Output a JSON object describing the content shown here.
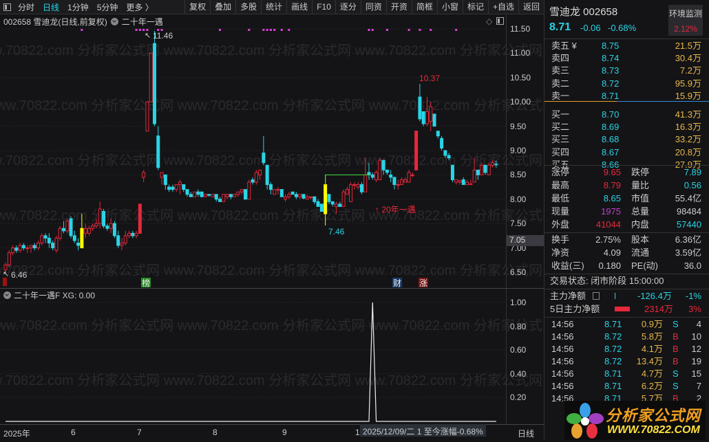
{
  "toolbar": {
    "left": [
      "分时",
      "日线",
      "1分钟",
      "5分钟",
      "更多 〉"
    ],
    "active": "日线",
    "right": [
      "复权",
      "叠加",
      "多股",
      "统计",
      "画线",
      "F10",
      "逐分",
      "同资",
      "开资",
      "简框",
      "小窗",
      "标记",
      "+自选",
      "返回"
    ]
  },
  "chart": {
    "code": "002658",
    "name_line": "002658 雪迪龙(日线,前复权)",
    "indicator": "二十年一遇",
    "price_ticks": [
      "11.50",
      "11.00",
      "10.50",
      "10.00",
      "9.50",
      "9.00",
      "8.50",
      "8.00",
      "7.50",
      "7.00",
      "6.50"
    ],
    "crosshair_price": "7.05",
    "labels": {
      "high": "11.46",
      "low": "6.46",
      "low2": "7.46",
      "high2": "10.37",
      "signal": "↑ 20年一遇"
    },
    "badges": [
      "榜",
      "财",
      "涨"
    ],
    "colors": {
      "up": "#e8283c",
      "down": "#2ad4e6",
      "signal": "#ffff00",
      "marker": "#e040e0"
    },
    "candles": [
      [
        6.55,
        6.7,
        6.46,
        6.65
      ],
      [
        6.65,
        6.95,
        6.6,
        6.9
      ],
      [
        6.9,
        7.05,
        6.85,
        7.0
      ],
      [
        7.0,
        7.05,
        6.9,
        6.95
      ],
      [
        6.95,
        7.1,
        6.9,
        7.05
      ],
      [
        7.05,
        7.1,
        6.95,
        7.0
      ],
      [
        7.0,
        7.05,
        6.9,
        7.0
      ],
      [
        7.0,
        7.05,
        6.9,
        7.05
      ],
      [
        7.05,
        7.1,
        6.95,
        7.0
      ],
      [
        7.0,
        7.15,
        6.95,
        7.1
      ],
      [
        7.1,
        7.3,
        7.05,
        7.25
      ],
      [
        7.25,
        7.3,
        7.1,
        7.2
      ],
      [
        7.2,
        7.3,
        7.0,
        7.1
      ],
      [
        7.1,
        7.15,
        6.95,
        7.0
      ],
      [
        6.95,
        7.25,
        6.9,
        7.2
      ],
      [
        7.2,
        7.45,
        7.15,
        7.4
      ],
      [
        7.4,
        7.55,
        7.3,
        7.35
      ],
      [
        7.35,
        7.6,
        7.3,
        7.55
      ],
      [
        7.6,
        7.65,
        7.2,
        7.25
      ],
      [
        7.25,
        7.35,
        7.1,
        7.15
      ],
      [
        7.1,
        7.2,
        6.95,
        7.05
      ],
      [
        7.4,
        7.7,
        7.0,
        7.0
      ],
      [
        7.3,
        7.5,
        7.2,
        7.4
      ],
      [
        7.3,
        7.45,
        7.25,
        7.4
      ],
      [
        7.4,
        7.5,
        7.35,
        7.45
      ],
      [
        7.45,
        7.6,
        7.4,
        7.5
      ],
      [
        7.5,
        7.95,
        7.4,
        7.8
      ],
      [
        7.75,
        7.8,
        7.4,
        7.45
      ],
      [
        7.45,
        7.5,
        7.35,
        7.4
      ],
      [
        7.4,
        7.6,
        7.3,
        7.5
      ],
      [
        7.5,
        7.55,
        7.2,
        7.25
      ],
      [
        7.25,
        7.35,
        7.0,
        7.05
      ],
      [
        7.05,
        7.2,
        6.95,
        7.1
      ],
      [
        7.1,
        7.35,
        7.05,
        7.25
      ],
      [
        7.25,
        7.35,
        7.2,
        7.3
      ],
      [
        7.3,
        7.35,
        7.2,
        7.25
      ],
      [
        7.25,
        7.35,
        7.2,
        7.3
      ],
      [
        7.3,
        7.9,
        7.3,
        7.9
      ],
      [
        8.45,
        8.6,
        8.35,
        8.55
      ],
      [
        9.4,
        10.0,
        9.4,
        10.0
      ],
      [
        10.0,
        11.0,
        10.0,
        11.0
      ],
      [
        11.2,
        11.46,
        9.5,
        9.55
      ],
      [
        9.3,
        9.5,
        8.6,
        8.65
      ],
      [
        8.45,
        8.55,
        8.3,
        8.55
      ],
      [
        8.5,
        8.5,
        8.2,
        8.3
      ],
      [
        8.25,
        8.3,
        8.15,
        8.2
      ],
      [
        8.25,
        8.3,
        8.15,
        8.2
      ],
      [
        8.2,
        8.3,
        8.15,
        8.3
      ],
      [
        8.3,
        8.4,
        8.1,
        8.35
      ],
      [
        8.3,
        8.3,
        8.15,
        8.2
      ],
      [
        8.2,
        8.2,
        8.05,
        8.1
      ],
      [
        8.1,
        8.15,
        8.05,
        8.05
      ],
      [
        8.05,
        8.15,
        8.05,
        8.15
      ],
      [
        8.15,
        8.2,
        8.05,
        8.1
      ],
      [
        8.15,
        8.15,
        8.05,
        8.05
      ],
      [
        8.05,
        8.1,
        8.05,
        8.1
      ],
      [
        8.1,
        8.1,
        8.05,
        8.08
      ],
      [
        8.05,
        8.1,
        8.05,
        8.1
      ],
      [
        8.1,
        8.1,
        7.95,
        8.0
      ],
      [
        8.0,
        8.05,
        7.95,
        7.95
      ],
      [
        7.95,
        8.1,
        7.95,
        8.1
      ],
      [
        8.05,
        8.1,
        8.0,
        8.1
      ],
      [
        8.1,
        8.1,
        8.0,
        8.05
      ],
      [
        8.05,
        8.1,
        8.05,
        8.1
      ],
      [
        8.1,
        8.15,
        8.05,
        8.15
      ],
      [
        8.15,
        8.2,
        8.1,
        8.2
      ],
      [
        8.2,
        8.2,
        8.0,
        8.0
      ],
      [
        8.0,
        8.4,
        8.0,
        8.35
      ],
      [
        8.4,
        8.45,
        8.3,
        8.35
      ],
      [
        8.35,
        8.6,
        8.3,
        8.55
      ],
      [
        8.5,
        8.6,
        8.4,
        8.6
      ],
      [
        8.95,
        9.3,
        8.7,
        8.75
      ],
      [
        8.7,
        8.7,
        8.2,
        8.3
      ],
      [
        8.3,
        8.35,
        8.1,
        8.2
      ],
      [
        8.1,
        8.2,
        8.1,
        8.2
      ],
      [
        8.2,
        8.25,
        8.1,
        8.2
      ],
      [
        8.2,
        8.2,
        8.05,
        8.05
      ],
      [
        8.0,
        8.1,
        7.95,
        8.05
      ],
      [
        8.05,
        8.15,
        8.0,
        8.1
      ],
      [
        8.15,
        8.15,
        8.1,
        8.1
      ],
      [
        8.1,
        8.15,
        8.0,
        8.05
      ],
      [
        8.05,
        8.1,
        8.0,
        8.1
      ],
      [
        8.1,
        8.1,
        8.0,
        8.02
      ],
      [
        8.0,
        8.1,
        8.0,
        8.05
      ],
      [
        8.05,
        8.05,
        8.0,
        8.05
      ],
      [
        8.05,
        8.05,
        7.9,
        7.95
      ],
      [
        7.95,
        8.0,
        7.85,
        7.85
      ],
      [
        7.9,
        7.9,
        7.75,
        7.75
      ],
      [
        8.3,
        8.5,
        7.46,
        7.7
      ],
      [
        8.1,
        8.1,
        7.9,
        7.95
      ],
      [
        7.95,
        7.95,
        7.85,
        7.9
      ],
      [
        7.85,
        7.95,
        7.7,
        7.9
      ],
      [
        7.9,
        7.95,
        7.85,
        7.85
      ],
      [
        7.85,
        8.2,
        7.85,
        8.15
      ],
      [
        8.1,
        8.25,
        8.1,
        8.2
      ],
      [
        7.95,
        8.35,
        7.95,
        8.3
      ],
      [
        8.3,
        8.35,
        8.2,
        8.3
      ],
      [
        8.25,
        8.35,
        8.2,
        8.3
      ],
      [
        8.3,
        8.35,
        8.1,
        8.15
      ],
      [
        8.15,
        8.85,
        8.15,
        8.5
      ],
      [
        8.55,
        8.75,
        8.4,
        8.5
      ],
      [
        8.5,
        8.55,
        8.4,
        8.45
      ],
      [
        8.4,
        8.6,
        8.35,
        8.55
      ],
      [
        8.4,
        8.85,
        8.4,
        8.8
      ],
      [
        8.8,
        8.8,
        8.5,
        8.6
      ],
      [
        8.6,
        8.6,
        8.5,
        8.55
      ],
      [
        8.5,
        8.6,
        8.35,
        8.45
      ],
      [
        8.45,
        8.45,
        8.2,
        8.3
      ],
      [
        8.3,
        8.4,
        8.2,
        8.3
      ],
      [
        8.3,
        8.45,
        8.3,
        8.4
      ],
      [
        8.35,
        8.45,
        8.35,
        8.4
      ],
      [
        8.35,
        8.6,
        8.35,
        8.55
      ],
      [
        8.5,
        8.55,
        8.45,
        8.5
      ],
      [
        8.6,
        9.4,
        8.6,
        9.4
      ],
      [
        10.1,
        10.37,
        9.6,
        9.65
      ],
      [
        9.8,
        9.8,
        9.5,
        9.55
      ],
      [
        9.55,
        10.1,
        9.5,
        9.8
      ],
      [
        9.6,
        10.0,
        9.4,
        9.9
      ],
      [
        9.75,
        9.75,
        9.5,
        9.5
      ],
      [
        9.4,
        9.4,
        9.25,
        9.3
      ],
      [
        9.25,
        9.3,
        9.0,
        9.05
      ],
      [
        9.0,
        9.0,
        8.85,
        8.9
      ],
      [
        8.9,
        8.95,
        8.8,
        8.85
      ],
      [
        8.7,
        8.7,
        8.35,
        8.4
      ],
      [
        8.35,
        8.4,
        8.3,
        8.4
      ],
      [
        8.35,
        8.4,
        8.3,
        8.38
      ],
      [
        8.4,
        8.45,
        8.3,
        8.3
      ],
      [
        8.3,
        8.4,
        8.3,
        8.35
      ],
      [
        8.3,
        8.4,
        8.3,
        8.32
      ],
      [
        8.35,
        8.85,
        8.35,
        8.6
      ],
      [
        8.6,
        8.6,
        8.4,
        8.5
      ],
      [
        8.5,
        8.75,
        8.5,
        8.7
      ],
      [
        8.7,
        8.7,
        8.5,
        8.55
      ],
      [
        8.5,
        8.75,
        8.5,
        8.7
      ],
      [
        8.7,
        8.8,
        8.65,
        8.75
      ],
      [
        8.72,
        8.79,
        8.65,
        8.71
      ]
    ],
    "signal_candles": [
      21,
      88
    ],
    "limit_up_candles": [
      37,
      113
    ],
    "signal_index": 101,
    "top_markers": [
      21,
      36,
      37,
      38,
      39,
      42,
      43,
      59,
      67,
      71,
      72,
      73,
      74,
      76,
      78,
      100,
      101,
      105,
      111,
      114,
      117,
      124
    ],
    "lower": {
      "title": "二十年一遇F XG: 0.00",
      "ticks": [
        "1.00",
        "0.80",
        "0.60",
        "0.40",
        "0.20"
      ]
    },
    "xaxis": {
      "labels": [
        "2025年",
        "6",
        "7",
        "8",
        "9",
        "1"
      ],
      "crosshair_date": "2025/12/09/二 1 至今涨幅-0.68%",
      "period": "日线"
    }
  },
  "quote": {
    "name": "雪迪龙 002658",
    "price": "8.71",
    "change": "-0.06",
    "pct": "-0.68%",
    "env_label": "环境监测",
    "env_pct": "2.12%",
    "asks": [
      [
        "卖五 ¥",
        "8.75",
        "21.5万"
      ],
      [
        "卖四",
        "8.74",
        "30.4万"
      ],
      [
        "卖三",
        "8.73",
        "7.2万"
      ],
      [
        "卖二",
        "8.72",
        "95.9万"
      ],
      [
        "卖一",
        "8.71",
        "15.9万"
      ]
    ],
    "bids": [
      [
        "买一",
        "8.70",
        "41.3万"
      ],
      [
        "买二",
        "8.69",
        "16.3万"
      ],
      [
        "买三",
        "8.68",
        "33.2万"
      ],
      [
        "买四",
        "8.67",
        "20.8万"
      ],
      [
        "买五",
        "8.66",
        "27.9万"
      ]
    ],
    "stats": [
      [
        "涨停",
        "9.65",
        "rd",
        "跌停",
        "7.89",
        "cy"
      ],
      [
        "最高",
        "8.79",
        "rd",
        "量比",
        "0.56",
        "cy"
      ],
      [
        "最低",
        "8.65",
        "cy",
        "市值",
        "55.4亿",
        "wh"
      ],
      [
        "现量",
        "1975",
        "pu",
        "总量",
        "98484",
        "wh"
      ],
      [
        "外盘",
        "41044",
        "rd",
        "内盘",
        "57440",
        "cy"
      ]
    ],
    "stats2": [
      [
        "换手",
        "2.75%",
        "股本",
        "6.36亿"
      ],
      [
        "净资",
        "4.09",
        "流通",
        "3.59亿"
      ],
      [
        "收益(三)",
        "0.180",
        "PE(动)",
        "36.0"
      ]
    ],
    "status": "交易状态: 闭市阶段 15:00:00",
    "main_flow": {
      "label": "主力净额",
      "value": "-126.4万",
      "pct": "-1%"
    },
    "flow5": {
      "label": "5日主力净额",
      "value": "2314万",
      "pct": "3%"
    },
    "ticks": [
      [
        "14:56",
        "8.71",
        "0.9万",
        "S",
        "4"
      ],
      [
        "14:56",
        "8.72",
        "5.8万",
        "B",
        "10"
      ],
      [
        "14:56",
        "8.72",
        "4.1万",
        "B",
        "12"
      ],
      [
        "14:56",
        "8.72",
        "13.4万",
        "B",
        "19"
      ],
      [
        "14:56",
        "8.71",
        "4.7万",
        "S",
        "15"
      ],
      [
        "14:56",
        "8.71",
        "6.2万",
        "S",
        "7"
      ],
      [
        "14:56",
        "8.71",
        "5.7万",
        "B",
        "2"
      ]
    ]
  },
  "watermark": "www.70822.com 分析家公式网",
  "logo": {
    "title": "分析家公式网",
    "url": "WWW.70822.COM"
  }
}
